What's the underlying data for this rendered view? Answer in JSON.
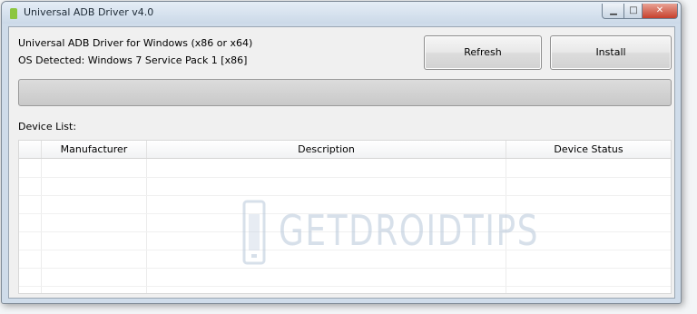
{
  "window": {
    "title": "Universal ADB Driver v4.0",
    "controls": {
      "minimize_glyph": "▁",
      "maximize_glyph": "□",
      "close_glyph": "✕"
    }
  },
  "info": {
    "driver_line": "Universal ADB Driver for Windows (x86 or x64)",
    "os_line": "OS Detected: Windows 7 Service Pack 1 [x86]"
  },
  "buttons": {
    "refresh_label": "Refresh",
    "install_label": "Install"
  },
  "progress": {
    "value_percent": 0
  },
  "device_list": {
    "label": "Device List:",
    "columns": [
      "",
      "Manufacturer",
      "Description",
      "Device Status"
    ],
    "rows": []
  },
  "watermark": {
    "text": "GETDROIDTIPS"
  },
  "colors": {
    "close_button": "#c7402c",
    "titlebar": "#cbd9e8",
    "client_bg": "#f0f0f0",
    "watermark": "#b8c7da"
  }
}
